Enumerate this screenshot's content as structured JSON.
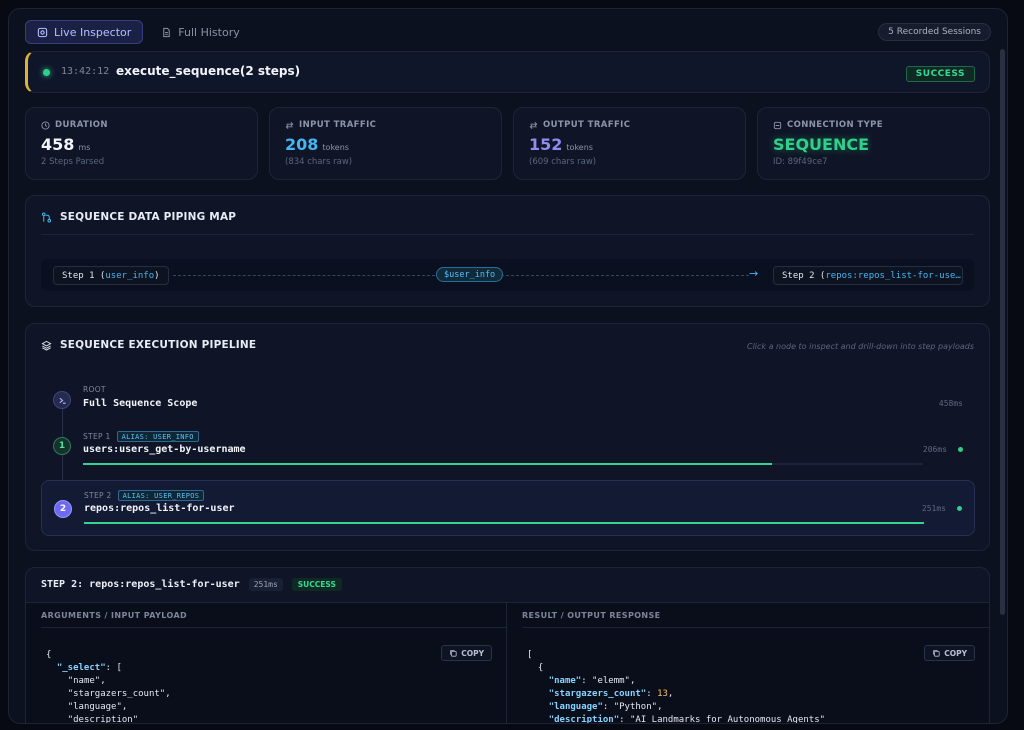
{
  "tabs": [
    {
      "label": "Live Inspector",
      "icon": "inspector-icon",
      "active": true
    },
    {
      "label": "Full History",
      "icon": "document-icon",
      "active": false
    }
  ],
  "sessions_badge": "5 Recorded Sessions",
  "event": {
    "time": "13:42:12",
    "title": "execute_sequence(2 steps)",
    "status": "SUCCESS"
  },
  "stats": {
    "duration": {
      "label": "DURATION",
      "value": "458",
      "unit": "ms",
      "sub": "2 Steps Parsed"
    },
    "input": {
      "label": "INPUT TRAFFIC",
      "value": "208",
      "unit": "tokens",
      "sub": "(834 chars raw)"
    },
    "output": {
      "label": "OUTPUT TRAFFIC",
      "value": "152",
      "unit": "tokens",
      "sub": "(609 chars raw)"
    },
    "connection": {
      "label": "CONNECTION TYPE",
      "value": "SEQUENCE",
      "sub": "ID: 89f49ce7"
    }
  },
  "piping": {
    "title": "SEQUENCE DATA PIPING MAP",
    "source_prefix": "Step 1 (",
    "source_alias": "user_info",
    "source_suffix": ")",
    "variable": "$user_info",
    "target_prefix": "Step 2 (",
    "target_alias": "repos:repos_list-for-use…"
  },
  "pipeline": {
    "title": "SEQUENCE EXECUTION PIPELINE",
    "hint": "Click a node to inspect and drill-down into step payloads",
    "root": {
      "eyebrow": "ROOT",
      "name": "Full Sequence Scope",
      "ms": "458ms"
    },
    "steps": [
      {
        "eyebrow": "STEP 1",
        "alias": "ALIAS: USER_INFO",
        "name": "users:users_get-by-username",
        "ms": "206ms",
        "num": "1",
        "progress": 0.82
      },
      {
        "eyebrow": "STEP 2",
        "alias": "ALIAS: USER_REPOS",
        "name": "repos:repos_list-for-user",
        "ms": "251ms",
        "num": "2",
        "progress": 1.0
      }
    ]
  },
  "detail": {
    "title": "STEP 2: repos:repos_list-for-user",
    "ms": "251ms",
    "status": "SUCCESS",
    "input_label": "ARGUMENTS / INPUT PAYLOAD",
    "output_label": "RESULT / OUTPUT RESPONSE",
    "copy_label": "COPY",
    "input_code": {
      "open": "{",
      "key": "\"_select\"",
      "open_array": ": [",
      "items": [
        "\"name\",",
        "\"stargazers_count\",",
        "\"language\",",
        "\"description\""
      ]
    },
    "output_code": {
      "open": "[",
      "obj_open": "{",
      "fields": [
        {
          "key": "\"name\"",
          "value": "\"elemm\"",
          "type": "s",
          "trail": ","
        },
        {
          "key": "\"stargazers_count\"",
          "value": "13",
          "type": "n",
          "trail": ","
        },
        {
          "key": "\"language\"",
          "value": "\"Python\"",
          "type": "s",
          "trail": ","
        },
        {
          "key": "\"description\"",
          "value": "\"AI Landmarks for Autonomous Agents\"",
          "type": "s",
          "trail": ""
        }
      ]
    }
  },
  "colors": {
    "accent_green": "#2fd08a",
    "accent_blue": "#45b6f2",
    "accent_purple": "#8f8cf2",
    "warning_gold": "#e0b038",
    "step1_circle": "#1b3a30",
    "step2_circle": "#6d6af0"
  }
}
